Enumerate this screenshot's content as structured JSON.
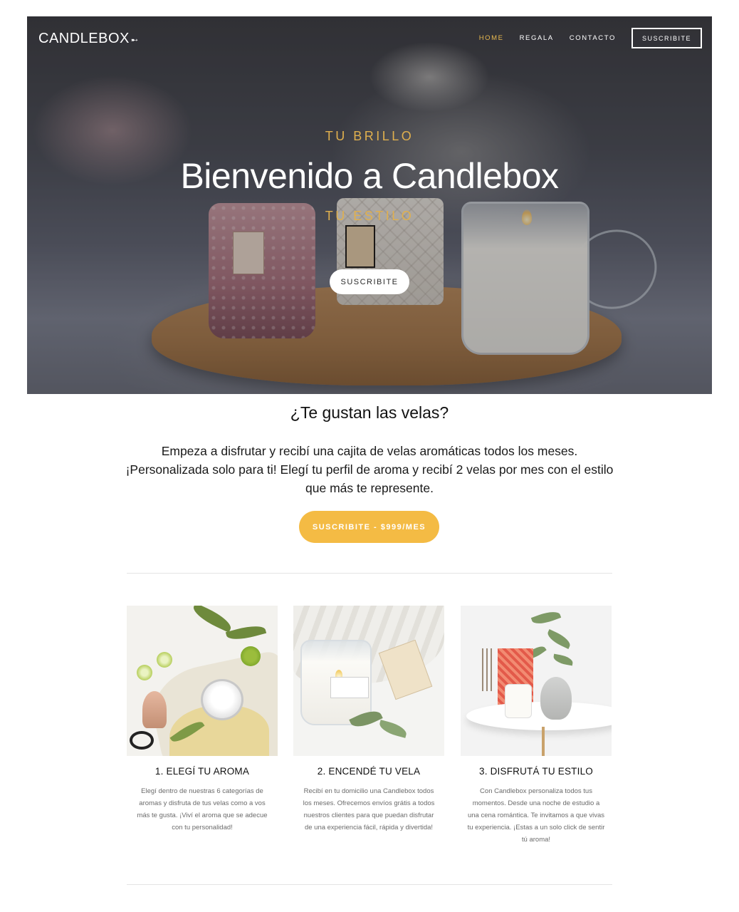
{
  "brand": {
    "logo_text": "CANDLEBOX",
    "logo_mark": "➸"
  },
  "nav": {
    "items": [
      {
        "label": "HOME",
        "active": true
      },
      {
        "label": "REGALA",
        "active": false
      },
      {
        "label": "CONTACTO",
        "active": false
      }
    ],
    "subscribe_label": "SUSCRIBITE"
  },
  "hero": {
    "kicker_top": "TU BRILLO",
    "title": "Bienvenido a Candlebox",
    "kicker_bottom": "TU ESTILO",
    "button_label": "SUSCRIBITE"
  },
  "intro": {
    "title": "¿Te gustan las velas?",
    "text": "Empeza a disfrutar y recibí una cajita de velas aromáticas todos los meses. ¡Personalizada solo para ti! Elegí  tu perfil de aroma y recibí 2 velas por mes con el estilo que más te represente.",
    "cta_label": "SUSCRIBITE - $999/MES"
  },
  "features": [
    {
      "title": "1. ELEGÍ TU AROMA",
      "text": "Elegí dentro de nuestras 6 categorías de aromas y disfruta de tus velas como a vos más te gusta. ¡Viví el aroma que se adecue con tu personalidad!"
    },
    {
      "title": "2. ENCENDÉ TU VELA",
      "text": "Recibí en tu domicilio una Candlebox todos los meses. Ofrecemos envíos grátis a todos nuestros clientes para que puedan disfrutar de una experiencia fácil, rápida y divertida!"
    },
    {
      "title": "3. DISFRUTÁ TU ESTILO",
      "text": "Con Candlebox personaliza todos tus momentos. Desde una noche de estudio a una cena romántica. Te invitamos a que vivas tu experiencia. ¡Estas a un solo click de sentir tú aroma!"
    }
  ],
  "colors": {
    "accent_gold": "#e8b94f",
    "cta_yellow": "#f4bb44",
    "text_dark": "#111111",
    "text_muted": "#6b6b6b"
  }
}
